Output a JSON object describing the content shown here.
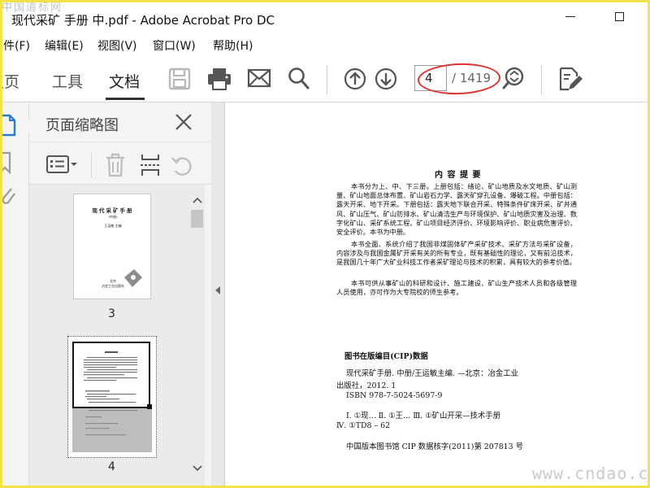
{
  "window": {
    "title": "现代采矿 手册 中.pdf - Adobe Acrobat Pro DC",
    "watermark_top": "中国道标网"
  },
  "menu": [
    {
      "label": "件(F)"
    },
    {
      "label": "编辑(E)"
    },
    {
      "label": "视图(V)"
    },
    {
      "label": "窗口(W)"
    },
    {
      "label": "帮助(H)"
    }
  ],
  "nav_tabs": [
    {
      "label": "主页"
    },
    {
      "label": "工具"
    },
    {
      "label": "文档"
    }
  ],
  "toolbar": {
    "current_page": "4",
    "total_pages": "/ 1419",
    "highlight_color": "#e03030"
  },
  "panel": {
    "title": "页面缩略图",
    "thumbnails": [
      {
        "label": "3",
        "title_text": "现代采矿手册",
        "subtitle": "(中册)",
        "editor": "王运敏  主编",
        "publisher": "北京\n冶金工业出版社"
      },
      {
        "label": "4"
      }
    ]
  },
  "document": {
    "heading": "内 容 提 要",
    "paragraphs": [
      "本书分为上、中、下三册。上册包括：绪论、矿山地质及水文地质、矿山测量、矿山地面总体布置、矿山岩石力学、露天矿穿孔设备、爆破工程。中册包括：露天开采、地下开采。下册包括：露天地下联合开采、特殊条件矿床开采、矿井通风、矿山压气、矿山防排水、矿山清洁生产与环境保护、矿山地质灾害及治理、数字化矿山、采矿系统工程、矿山项目经济评价、环境影响评价、职业病危害评价、安全评价。本书为中册。",
      "本书全面、系统介绍了我国非煤固体矿产采矿技术、采矿方法与采矿设备，内容涉及与我国金属矿开采有关的所有专业，既有基础性的理论，又有前沿技术，是我国几十年广大矿业科技工作者采矿理论与技术的积累，具有较大的参考价值。",
      "本书可供从事矿山的科研和设计、施工建设、矿山生产技术人员和各级管理人员使用，亦可作为大专院校的师生参考。"
    ],
    "cip": {
      "title": "图书在版编目(CIP)数据",
      "lines": [
        "现代采矿手册. 中册/王运敏主编. —北京：冶金工业",
        "出版社，2012. 1",
        "ISBN 978-7-5024-5697-9",
        "Ⅰ. ①现…    Ⅱ. ①王…    Ⅲ. ①矿山开采—技术手册",
        "Ⅳ. ①TD8 – 62",
        "中国版本图书馆 CIP 数据核字(2011)第 207813 号"
      ]
    }
  },
  "watermark_bottom": "www.cndao.com"
}
